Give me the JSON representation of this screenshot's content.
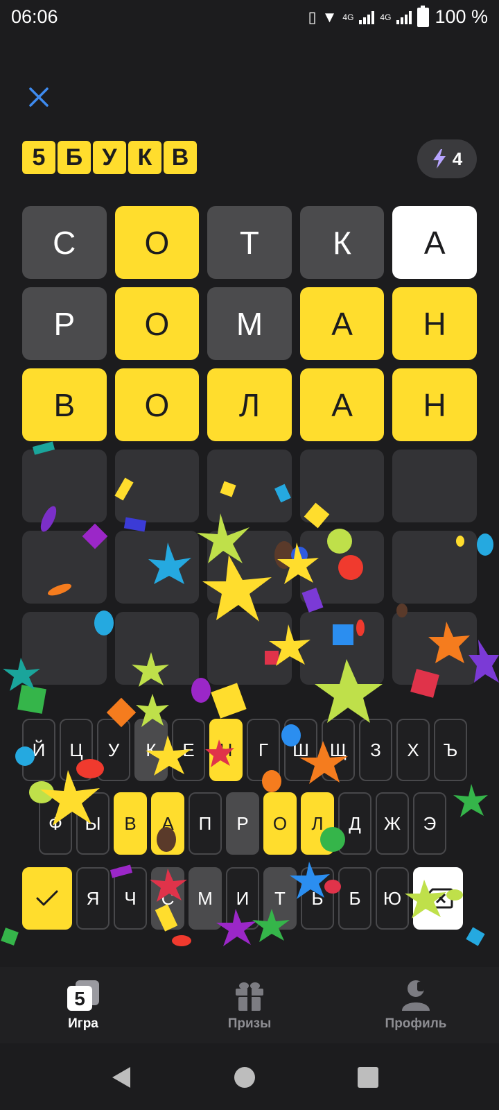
{
  "status": {
    "time": "06:06",
    "net1": "4G",
    "net2": "4G",
    "battery": "100 %"
  },
  "header": {
    "logo_letters": [
      "5",
      "Б",
      "У",
      "К",
      "В"
    ],
    "energy_count": "4"
  },
  "grid": [
    [
      {
        "l": "С",
        "s": "gray"
      },
      {
        "l": "О",
        "s": "yellow"
      },
      {
        "l": "Т",
        "s": "gray"
      },
      {
        "l": "К",
        "s": "gray"
      },
      {
        "l": "А",
        "s": "white"
      }
    ],
    [
      {
        "l": "Р",
        "s": "gray"
      },
      {
        "l": "О",
        "s": "yellow"
      },
      {
        "l": "М",
        "s": "gray"
      },
      {
        "l": "А",
        "s": "yellow"
      },
      {
        "l": "Н",
        "s": "yellow"
      }
    ],
    [
      {
        "l": "В",
        "s": "yellow"
      },
      {
        "l": "О",
        "s": "yellow"
      },
      {
        "l": "Л",
        "s": "yellow"
      },
      {
        "l": "А",
        "s": "yellow"
      },
      {
        "l": "Н",
        "s": "yellow"
      }
    ],
    [
      {
        "l": "",
        "s": "empty"
      },
      {
        "l": "",
        "s": "empty"
      },
      {
        "l": "",
        "s": "empty"
      },
      {
        "l": "",
        "s": "empty"
      },
      {
        "l": "",
        "s": "empty"
      }
    ],
    [
      {
        "l": "",
        "s": "empty"
      },
      {
        "l": "",
        "s": "empty"
      },
      {
        "l": "",
        "s": "empty"
      },
      {
        "l": "",
        "s": "empty"
      },
      {
        "l": "",
        "s": "empty"
      }
    ],
    [
      {
        "l": "",
        "s": "empty"
      },
      {
        "l": "",
        "s": "empty"
      },
      {
        "l": "",
        "s": "empty"
      },
      {
        "l": "",
        "s": "empty"
      },
      {
        "l": "",
        "s": "empty"
      }
    ]
  ],
  "keyboard": {
    "row1": [
      {
        "k": "Й",
        "s": ""
      },
      {
        "k": "Ц",
        "s": ""
      },
      {
        "k": "У",
        "s": ""
      },
      {
        "k": "К",
        "s": "gray"
      },
      {
        "k": "Е",
        "s": ""
      },
      {
        "k": "Н",
        "s": "yellow"
      },
      {
        "k": "Г",
        "s": ""
      },
      {
        "k": "Ш",
        "s": ""
      },
      {
        "k": "Щ",
        "s": ""
      },
      {
        "k": "З",
        "s": ""
      },
      {
        "k": "Х",
        "s": ""
      },
      {
        "k": "Ъ",
        "s": ""
      }
    ],
    "row2": [
      {
        "k": "Ф",
        "s": ""
      },
      {
        "k": "Ы",
        "s": ""
      },
      {
        "k": "В",
        "s": "yellow"
      },
      {
        "k": "А",
        "s": "yellow"
      },
      {
        "k": "П",
        "s": ""
      },
      {
        "k": "Р",
        "s": "gray"
      },
      {
        "k": "О",
        "s": "yellow"
      },
      {
        "k": "Л",
        "s": "yellow"
      },
      {
        "k": "Д",
        "s": ""
      },
      {
        "k": "Ж",
        "s": ""
      },
      {
        "k": "Э",
        "s": ""
      }
    ],
    "row3": [
      {
        "k": "Я",
        "s": ""
      },
      {
        "k": "Ч",
        "s": ""
      },
      {
        "k": "С",
        "s": "gray"
      },
      {
        "k": "М",
        "s": "gray"
      },
      {
        "k": "И",
        "s": ""
      },
      {
        "k": "Т",
        "s": "gray"
      },
      {
        "k": "Ь",
        "s": ""
      },
      {
        "k": "Б",
        "s": ""
      },
      {
        "k": "Ю",
        "s": ""
      }
    ]
  },
  "bottom_nav": {
    "items": [
      {
        "label": "Игра",
        "icon": "game-icon",
        "active": true,
        "badge": "5"
      },
      {
        "label": "Призы",
        "icon": "gift-icon",
        "active": false
      },
      {
        "label": "Профиль",
        "icon": "profile-icon",
        "active": false
      }
    ]
  },
  "colors": {
    "accent": "#ffdd2d",
    "present": "#ffdd2d",
    "absent": "#4b4b4d",
    "background": "#1c1c1e"
  }
}
